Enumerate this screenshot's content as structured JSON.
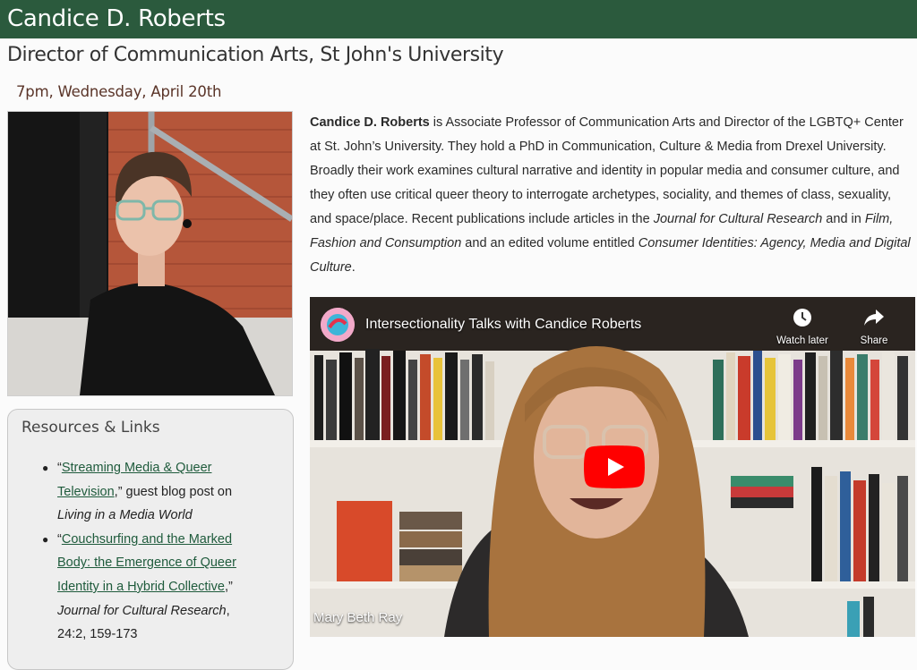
{
  "header": {
    "name": "Candice D. Roberts"
  },
  "subtitle": "Director of Communication Arts, St John's University",
  "event_time": "7pm, Wednesday, April 20th",
  "colors": {
    "header_bg": "#2b5a3d",
    "link": "#1f5b3c",
    "time": "#5a3428",
    "play_red": "#ff0000"
  },
  "bio": {
    "name_bold": "Candice D. Roberts",
    "part1": " is Associate Professor of Communication Arts and Director of the LGBTQ+ Center at St. John’s University. They hold a PhD in Communication, Culture & Media from Drexel University. Broadly their work examines cultural narrative and identity in popular media and consumer culture, and they often use critical queer theory to interrogate archetypes, sociality, and themes of class, sexuality, and space/place. Recent publications include articles in the ",
    "journal1": "Journal for Cultural Research",
    "part2": " and in ",
    "journal2": "Film, Fashion and Consumption",
    "part3": " and an edited volume entitled ",
    "book": "Consumer Identities: Agency, Media and Digital Culture",
    "part4": "."
  },
  "resources": {
    "title": "Resources & Links",
    "items": [
      {
        "open_quote": "“",
        "link": "Streaming Media & Queer Television",
        "after_link": ",” guest blog post on ",
        "italic": "Living in a Media World",
        "tail": ""
      },
      {
        "open_quote": "“",
        "link": "Couchsurfing and the Marked Body: the Emergence of Queer Identity in a Hybrid Collective",
        "after_link": ",” ",
        "italic": "Journal for Cultural Research",
        "tail": ", 24:2, 159-173"
      }
    ]
  },
  "video": {
    "title": "Intersectionality Talks with Candice Roberts",
    "watch_later": "Watch later",
    "share": "Share",
    "caption_name": "Mary Beth Ray",
    "icons": [
      "channel-logo-icon",
      "clock-icon",
      "share-arrow-icon",
      "play-icon"
    ]
  }
}
